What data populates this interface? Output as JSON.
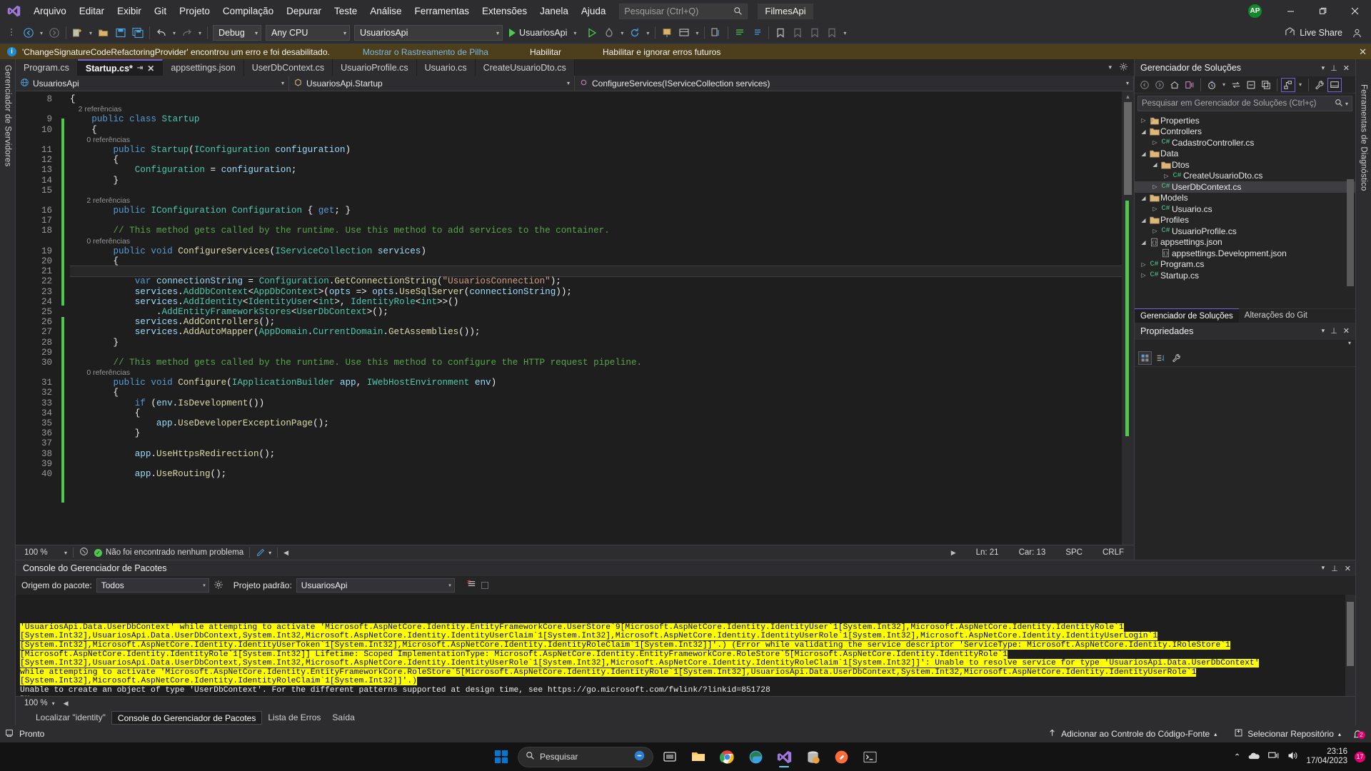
{
  "titlebar": {
    "logo": "vs-logo",
    "menus": [
      "Arquivo",
      "Editar",
      "Exibir",
      "Git",
      "Projeto",
      "Compilação",
      "Depurar",
      "Teste",
      "Análise",
      "Ferramentas",
      "Extensões",
      "Janela",
      "Ajuda"
    ],
    "search_placeholder": "Pesquisar (Ctrl+Q)",
    "project_badge": "FilmesApi",
    "avatar_initials": "AP",
    "window_minimize": "–",
    "window_restore": "❐",
    "window_close": "✕"
  },
  "toolbar": {
    "config_combo": "Debug",
    "platform_combo": "Any CPU",
    "target_combo": "UsuariosApi",
    "run_label": "UsuariosApi",
    "live_share": "Live Share"
  },
  "notification": {
    "message": "'ChangeSignatureCodeRefactoringProvider' encontrou um erro e foi desabilitado.",
    "link_stack": "Mostrar o Rastreamento de Pilha",
    "link_enable": "Habilitar",
    "link_enable_ignore": "Habilitar e ignorar erros futuros",
    "close": "✕"
  },
  "left_dock": {
    "label": "Gerenciador de Servidores"
  },
  "right_dock": {
    "label": "Ferramentas de Diagnóstico"
  },
  "editor": {
    "tabs": [
      {
        "label": "Program.cs",
        "active": false,
        "pinned": false
      },
      {
        "label": "Startup.cs*",
        "active": true,
        "pinned": true
      },
      {
        "label": "appsettings.json",
        "active": false,
        "pinned": false
      },
      {
        "label": "UserDbContext.cs",
        "active": false,
        "pinned": false
      },
      {
        "label": "UsuarioProfile.cs",
        "active": false,
        "pinned": false
      },
      {
        "label": "Usuario.cs",
        "active": false,
        "pinned": false
      },
      {
        "label": "CreateUsuarioDto.cs",
        "active": false,
        "pinned": false
      }
    ],
    "nav_project": "UsuariosApi",
    "nav_type": "UsuariosApi.Startup",
    "nav_member": "ConfigureServices(IServiceCollection services)",
    "first_line_number": 8,
    "lines": [
      {
        "n": 8,
        "ref": null,
        "indent": 0,
        "fold": false,
        "text": "{"
      },
      {
        "n": 9,
        "ref": "2 referências",
        "indent": 1,
        "fold": true,
        "text": "public class Startup"
      },
      {
        "n": 10,
        "ref": null,
        "indent": 1,
        "fold": false,
        "text": "{"
      },
      {
        "n": 11,
        "ref": "0 referências",
        "indent": 2,
        "fold": true,
        "text": "public Startup(IConfiguration configuration)"
      },
      {
        "n": 12,
        "ref": null,
        "indent": 2,
        "fold": false,
        "text": "{"
      },
      {
        "n": 13,
        "ref": null,
        "indent": 3,
        "fold": false,
        "text": "Configuration = configuration;"
      },
      {
        "n": 14,
        "ref": null,
        "indent": 2,
        "fold": false,
        "text": "}"
      },
      {
        "n": 15,
        "ref": null,
        "indent": 0,
        "fold": false,
        "text": ""
      },
      {
        "n": 16,
        "ref": "2 referências",
        "indent": 2,
        "fold": false,
        "text": "public IConfiguration Configuration { get; }"
      },
      {
        "n": 17,
        "ref": null,
        "indent": 0,
        "fold": false,
        "text": ""
      },
      {
        "n": 18,
        "ref": null,
        "indent": 2,
        "fold": false,
        "text": "// This method gets called by the runtime. Use this method to add services to the container."
      },
      {
        "n": 19,
        "ref": "0 referências",
        "indent": 2,
        "fold": true,
        "text": "public void ConfigureServices(IServiceCollection services)"
      },
      {
        "n": 20,
        "ref": null,
        "indent": 2,
        "fold": false,
        "text": "{"
      },
      {
        "n": 21,
        "ref": null,
        "indent": 3,
        "fold": false,
        "text": "",
        "cursor": true
      },
      {
        "n": 22,
        "ref": null,
        "indent": 3,
        "fold": false,
        "text": "var connectionString = Configuration.GetConnectionString(\"UsuariosConnection\");"
      },
      {
        "n": 23,
        "ref": null,
        "indent": 3,
        "fold": false,
        "text": "services.AddDbContext<AppDbContext>(opts => opts.UseSqlServer(connectionString));"
      },
      {
        "n": 24,
        "ref": null,
        "indent": 3,
        "fold": false,
        "text": "services.AddIdentity<IdentityUser<int>, IdentityRole<int>>()"
      },
      {
        "n": 25,
        "ref": null,
        "indent": 4,
        "fold": false,
        "text": ".AddEntityFrameworkStores<UserDbContext>();"
      },
      {
        "n": 26,
        "ref": null,
        "indent": 3,
        "fold": false,
        "text": "services.AddControllers();"
      },
      {
        "n": 27,
        "ref": null,
        "indent": 3,
        "fold": false,
        "text": "services.AddAutoMapper(AppDomain.CurrentDomain.GetAssemblies());"
      },
      {
        "n": 28,
        "ref": null,
        "indent": 2,
        "fold": false,
        "text": "}"
      },
      {
        "n": 29,
        "ref": null,
        "indent": 0,
        "fold": false,
        "text": ""
      },
      {
        "n": 30,
        "ref": null,
        "indent": 2,
        "fold": false,
        "text": "// This method gets called by the runtime. Use this method to configure the HTTP request pipeline."
      },
      {
        "n": 31,
        "ref": "0 referências",
        "indent": 2,
        "fold": true,
        "text": "public void Configure(IApplicationBuilder app, IWebHostEnvironment env)"
      },
      {
        "n": 32,
        "ref": null,
        "indent": 2,
        "fold": false,
        "text": "{"
      },
      {
        "n": 33,
        "ref": null,
        "indent": 3,
        "fold": true,
        "text": "if (env.IsDevelopment())"
      },
      {
        "n": 34,
        "ref": null,
        "indent": 3,
        "fold": false,
        "text": "{"
      },
      {
        "n": 35,
        "ref": null,
        "indent": 4,
        "fold": false,
        "text": "app.UseDeveloperExceptionPage();"
      },
      {
        "n": 36,
        "ref": null,
        "indent": 3,
        "fold": false,
        "text": "}"
      },
      {
        "n": 37,
        "ref": null,
        "indent": 0,
        "fold": false,
        "text": ""
      },
      {
        "n": 38,
        "ref": null,
        "indent": 3,
        "fold": false,
        "text": "app.UseHttpsRedirection();"
      },
      {
        "n": 39,
        "ref": null,
        "indent": 0,
        "fold": false,
        "text": ""
      },
      {
        "n": 40,
        "ref": null,
        "indent": 3,
        "fold": false,
        "text": "app.UseRouting();"
      }
    ],
    "status": {
      "zoom": "100 %",
      "problems": "Não foi encontrado nenhum problema",
      "line": "Ln: 21",
      "col": "Car: 13",
      "spaces": "SPC",
      "eol": "CRLF"
    }
  },
  "solution_explorer": {
    "title": "Gerenciador de Soluções",
    "search_placeholder": "Pesquisar em Gerenciador de Soluções (Ctrl+ç)",
    "tree": [
      {
        "label": "Properties",
        "depth": 0,
        "icon": "properties-icon",
        "arrow": "collapsed",
        "selected": false
      },
      {
        "label": "Controllers",
        "depth": 0,
        "icon": "folder-icon",
        "arrow": "expanded",
        "selected": false
      },
      {
        "label": "CadastroController.cs",
        "depth": 1,
        "icon": "csharp-icon",
        "arrow": "collapsed",
        "selected": false
      },
      {
        "label": "Data",
        "depth": 0,
        "icon": "folder-icon",
        "arrow": "expanded",
        "selected": false
      },
      {
        "label": "Dtos",
        "depth": 1,
        "icon": "folder-icon",
        "arrow": "expanded",
        "selected": false
      },
      {
        "label": "CreateUsuarioDto.cs",
        "depth": 2,
        "icon": "csharp-icon",
        "arrow": "collapsed",
        "selected": false
      },
      {
        "label": "UserDbContext.cs",
        "depth": 1,
        "icon": "csharp-icon",
        "arrow": "collapsed",
        "selected": true
      },
      {
        "label": "Models",
        "depth": 0,
        "icon": "folder-icon",
        "arrow": "expanded",
        "selected": false
      },
      {
        "label": "Usuario.cs",
        "depth": 1,
        "icon": "csharp-icon",
        "arrow": "collapsed",
        "selected": false
      },
      {
        "label": "Profiles",
        "depth": 0,
        "icon": "folder-icon",
        "arrow": "expanded",
        "selected": false
      },
      {
        "label": "UsuarioProfile.cs",
        "depth": 1,
        "icon": "csharp-icon",
        "arrow": "collapsed",
        "selected": false
      },
      {
        "label": "appsettings.json",
        "depth": 0,
        "icon": "json-icon",
        "arrow": "expanded",
        "selected": false
      },
      {
        "label": "appsettings.Development.json",
        "depth": 1,
        "icon": "json-icon",
        "arrow": "none",
        "selected": false
      },
      {
        "label": "Program.cs",
        "depth": 0,
        "icon": "csharp-icon",
        "arrow": "collapsed",
        "selected": false
      },
      {
        "label": "Startup.cs",
        "depth": 0,
        "icon": "csharp-icon",
        "arrow": "collapsed",
        "selected": false
      }
    ],
    "tabs": [
      {
        "label": "Gerenciador de Soluções",
        "active": true
      },
      {
        "label": "Alterações do Git",
        "active": false
      }
    ]
  },
  "properties_panel": {
    "title": "Propriedades"
  },
  "console": {
    "title": "Console do Gerenciador de Pacotes",
    "source_label": "Origem do pacote:",
    "source_value": "Todos",
    "project_label": "Projeto padrão:",
    "project_value": "UsuariosApi",
    "output_lines": [
      {
        "text": "'UsuariosApi.Data.UserDbContext' while attempting to activate 'Microsoft.AspNetCore.Identity.EntityFrameworkCore.UserStore`9[Microsoft.AspNetCore.Identity.IdentityUser`1[System.Int32],Microsoft.AspNetCore.Identity.IdentityRole`1",
        "err": true
      },
      {
        "text": "[System.Int32],UsuariosApi.Data.UserDbContext,System.Int32,Microsoft.AspNetCore.Identity.IdentityUserClaim`1[System.Int32],Microsoft.AspNetCore.Identity.IdentityUserRole`1[System.Int32],Microsoft.AspNetCore.Identity.IdentityUserLogin`1",
        "err": true
      },
      {
        "text": "[System.Int32],Microsoft.AspNetCore.Identity.IdentityUserToken`1[System.Int32],Microsoft.AspNetCore.Identity.IdentityRoleClaim`1[System.Int32]]'.) (Error while validating the service descriptor 'ServiceType: Microsoft.AspNetCore.Identity.IRoleStore`1",
        "err": true
      },
      {
        "text": "[Microsoft.AspNetCore.Identity.IdentityRole`1[System.Int32]] Lifetime: Scoped ImplementationType: Microsoft.AspNetCore.Identity.EntityFrameworkCore.RoleStore`5[Microsoft.AspNetCore.Identity.IdentityRole`1",
        "err": true
      },
      {
        "text": "[System.Int32],UsuariosApi.Data.UserDbContext,System.Int32,Microsoft.AspNetCore.Identity.IdentityUserRole`1[System.Int32],Microsoft.AspNetCore.Identity.IdentityRoleClaim`1[System.Int32]]': Unable to resolve service for type 'UsuariosApi.Data.UserDbContext'",
        "err": true
      },
      {
        "text": "while attempting to activate 'Microsoft.AspNetCore.Identity.EntityFrameworkCore.RoleStore`5[Microsoft.AspNetCore.Identity.IdentityRole`1[System.Int32],UsuariosApi.Data.UserDbContext,System.Int32,Microsoft.AspNetCore.Identity.IdentityUserRole`1",
        "err": true
      },
      {
        "text": "[System.Int32],Microsoft.AspNetCore.Identity.IdentityRoleClaim`1[System.Int32]]'.)",
        "err": true
      },
      {
        "text": "Unable to create an object of type 'UserDbContext'. For the different patterns supported at design time, see https://go.microsoft.com/fwlink/?linkid=851728",
        "err": false
      },
      {
        "text": "PM>",
        "err": false
      }
    ],
    "zoom": "100 %"
  },
  "bottom_tabs": [
    {
      "label": "Localizar \"identity\"",
      "active": false
    },
    {
      "label": "Console do Gerenciador de Pacotes",
      "active": true
    },
    {
      "label": "Lista de Erros",
      "active": false
    },
    {
      "label": "Saída",
      "active": false
    }
  ],
  "vs_status": {
    "ready": "Pronto",
    "source_control": "Adicionar ao Controle do Código-Fonte",
    "repository": "Selecionar Repositório",
    "notif_count": "2"
  },
  "taskbar": {
    "search_placeholder": "Pesquisar",
    "time": "23:16",
    "date": "17/04/2023",
    "badge": "17"
  },
  "colors": {
    "accent": "#7160e8",
    "error_highlight": "#ffff00",
    "notif_bg": "#4d3f1b",
    "green": "#4ec94e"
  }
}
